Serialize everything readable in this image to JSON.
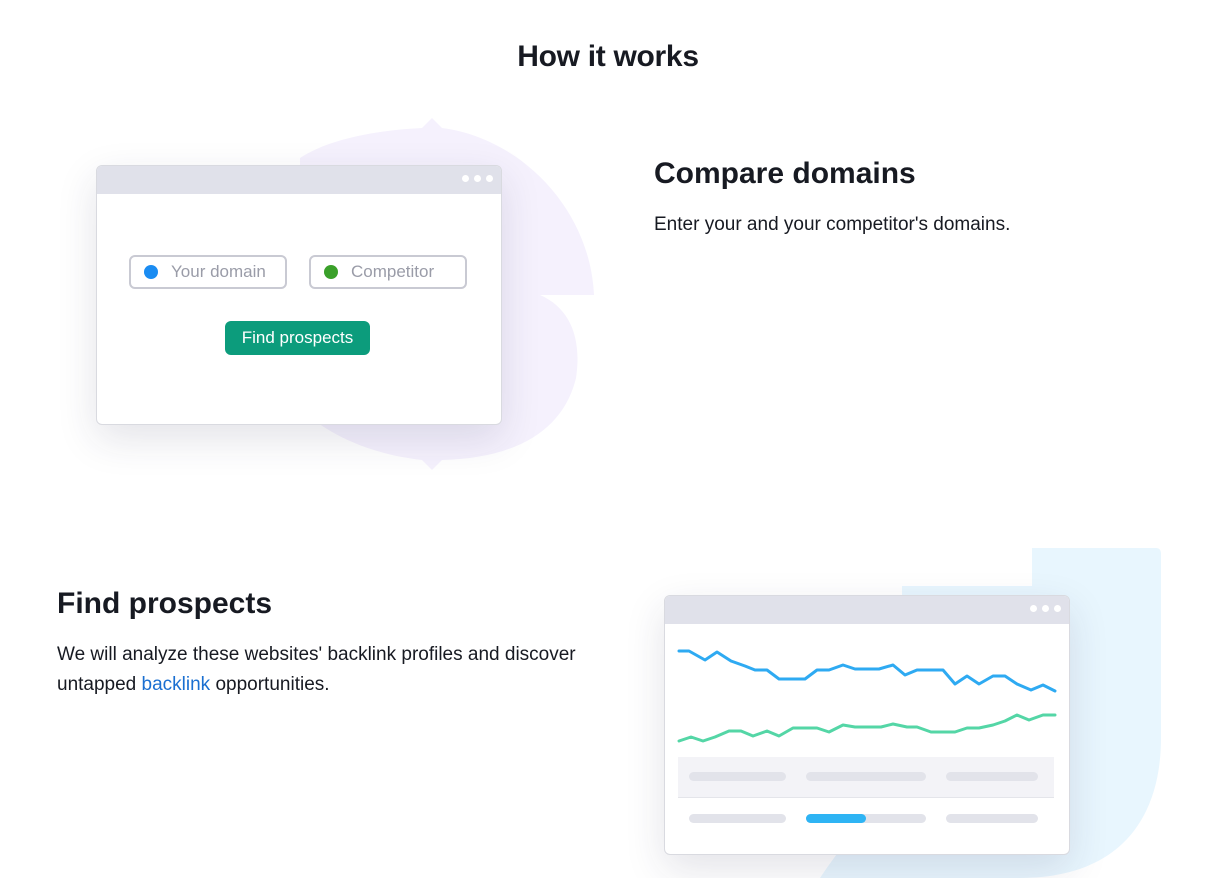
{
  "page": {
    "title": "How it works"
  },
  "steps": [
    {
      "title": "Compare domains",
      "description": "Enter your and your competitor's domains.",
      "mockup": {
        "your_domain_placeholder": "Your domain",
        "competitor_placeholder": "Competitor",
        "button_label": "Find prospects"
      }
    },
    {
      "title": "Find prospects",
      "description_before": "We will analyze these websites' backlink profiles and discover untapped ",
      "description_link": "backlink",
      "description_after": " opportunities.",
      "mockup": {
        "progress_value": 0.5
      }
    }
  ],
  "colors": {
    "your_domain_marker": "#1a8cf2",
    "competitor_marker": "#3aa02a",
    "button": "#0c9c7c",
    "line_blue": "#2eaaf2",
    "line_green": "#54d6a6",
    "progress_fill": "#2eb4f4",
    "blob_lilac": "#f5f1fd",
    "blob_blue": "#e8f6fe"
  },
  "icons": [
    "window-dots-icon",
    "blue-circle-icon",
    "green-circle-icon"
  ]
}
